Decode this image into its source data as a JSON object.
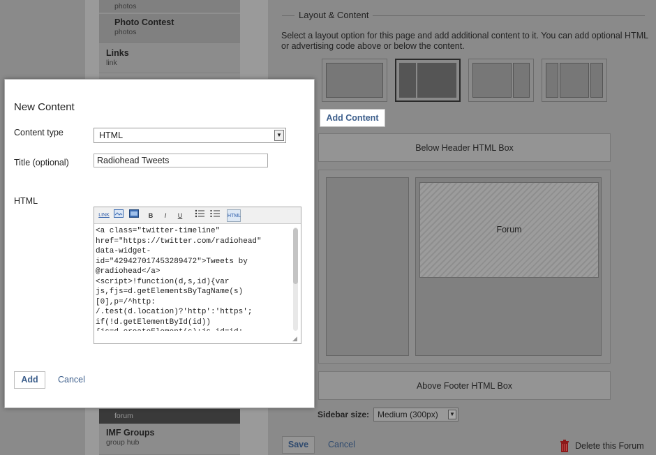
{
  "nav": {
    "items": [
      {
        "title": "",
        "sub": "photos"
      },
      {
        "title": "Photo Contest",
        "sub": "photos"
      },
      {
        "title": "Links",
        "sub": "link"
      }
    ],
    "bottom_items": [
      {
        "title": "",
        "sub": "forum"
      },
      {
        "title": "IMF Groups",
        "sub": "group hub"
      }
    ]
  },
  "layout_section": {
    "legend": "Layout & Content",
    "description": "Select a layout option for this page and add additional content to it. You can add optional HTML or advertising code above or below the content.",
    "add_content_label": "Add Content",
    "below_header_label": "Below Header HTML Box",
    "forum_label": "Forum",
    "above_footer_label": "Above Footer HTML Box",
    "sidebar_size_label": "Sidebar size:",
    "sidebar_size_value": "Medium (300px)",
    "save_label": "Save",
    "cancel_label": "Cancel",
    "delete_label": "Delete this Forum"
  },
  "modal": {
    "title": "New Content",
    "content_type_label": "Content type",
    "content_type_value": "HTML",
    "title_label": "Title (optional)",
    "title_value": "Radiohead Tweets",
    "html_label": "HTML",
    "toolbar": {
      "link": "LINK",
      "bold": "B",
      "italic": "I",
      "underline": "U",
      "html": "HTML"
    },
    "code_lines": [
      "<a class=\"twitter-timeline\"",
      "href=\"https://twitter.com/radiohead\"",
      "data-widget-",
      "id=\"429427017453289472\">Tweets by",
      "@radiohead</a>",
      "<script>!function(d,s,id){var",
      "js,fjs=d.getElementsByTagName(s)",
      "[0],p=/^http:",
      "/.test(d.location)?'http':'https';",
      "if(!d.getElementById(id))",
      "{js=d.createElement(s);js.id=id;"
    ],
    "add_label": "Add",
    "cancel_label": "Cancel"
  }
}
